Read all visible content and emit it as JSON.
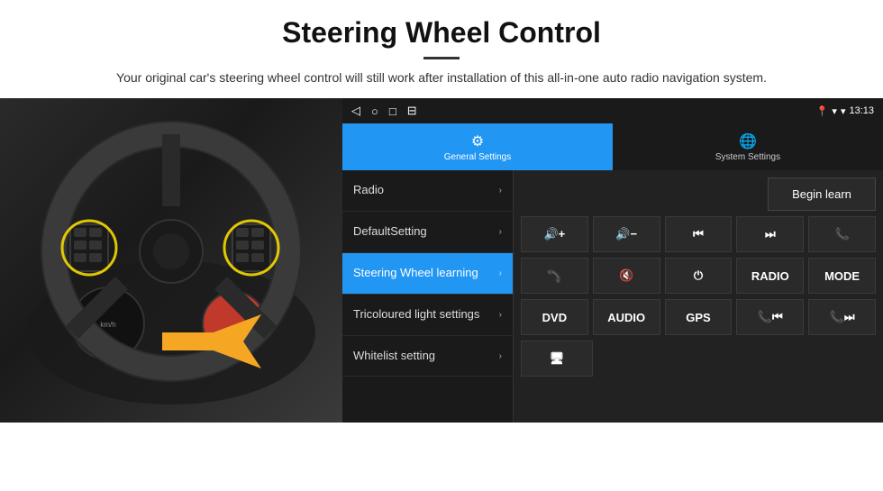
{
  "header": {
    "title": "Steering Wheel Control",
    "subtitle": "Your original car's steering wheel control will still work after installation of this all-in-one auto radio navigation system."
  },
  "status_bar": {
    "time": "13:13",
    "nav_icons": [
      "◁",
      "○",
      "□",
      "⊟"
    ]
  },
  "tabs": [
    {
      "id": "general",
      "label": "General Settings",
      "icon": "⚙",
      "active": true
    },
    {
      "id": "system",
      "label": "System Settings",
      "icon": "🌐",
      "active": false
    }
  ],
  "menu": {
    "items": [
      {
        "label": "Radio",
        "active": false
      },
      {
        "label": "DefaultSetting",
        "active": false
      },
      {
        "label": "Steering Wheel learning",
        "active": true
      },
      {
        "label": "Tricoloured light settings",
        "active": false
      },
      {
        "label": "Whitelist setting",
        "active": false
      }
    ]
  },
  "right_panel": {
    "begin_learn_label": "Begin learn",
    "control_rows": [
      [
        {
          "symbol": "🔊+",
          "label": "vol-up"
        },
        {
          "symbol": "🔊−",
          "label": "vol-down"
        },
        {
          "symbol": "⏮",
          "label": "prev-track"
        },
        {
          "symbol": "⏭",
          "label": "next-track"
        },
        {
          "symbol": "📞",
          "label": "call"
        }
      ],
      [
        {
          "symbol": "📞",
          "label": "answer",
          "style": "rotate"
        },
        {
          "symbol": "🔇",
          "label": "mute"
        },
        {
          "symbol": "⏻",
          "label": "power"
        },
        {
          "symbol": "RADIO",
          "label": "radio-btn"
        },
        {
          "symbol": "MODE",
          "label": "mode-btn"
        }
      ],
      [
        {
          "symbol": "DVD",
          "label": "dvd-btn"
        },
        {
          "symbol": "AUDIO",
          "label": "audio-btn"
        },
        {
          "symbol": "GPS",
          "label": "gps-btn"
        },
        {
          "symbol": "📞⏮",
          "label": "call-prev"
        },
        {
          "symbol": "📞⏭",
          "label": "call-next"
        }
      ],
      [
        {
          "symbol": "🖥",
          "label": "screen-btn"
        }
      ]
    ]
  }
}
